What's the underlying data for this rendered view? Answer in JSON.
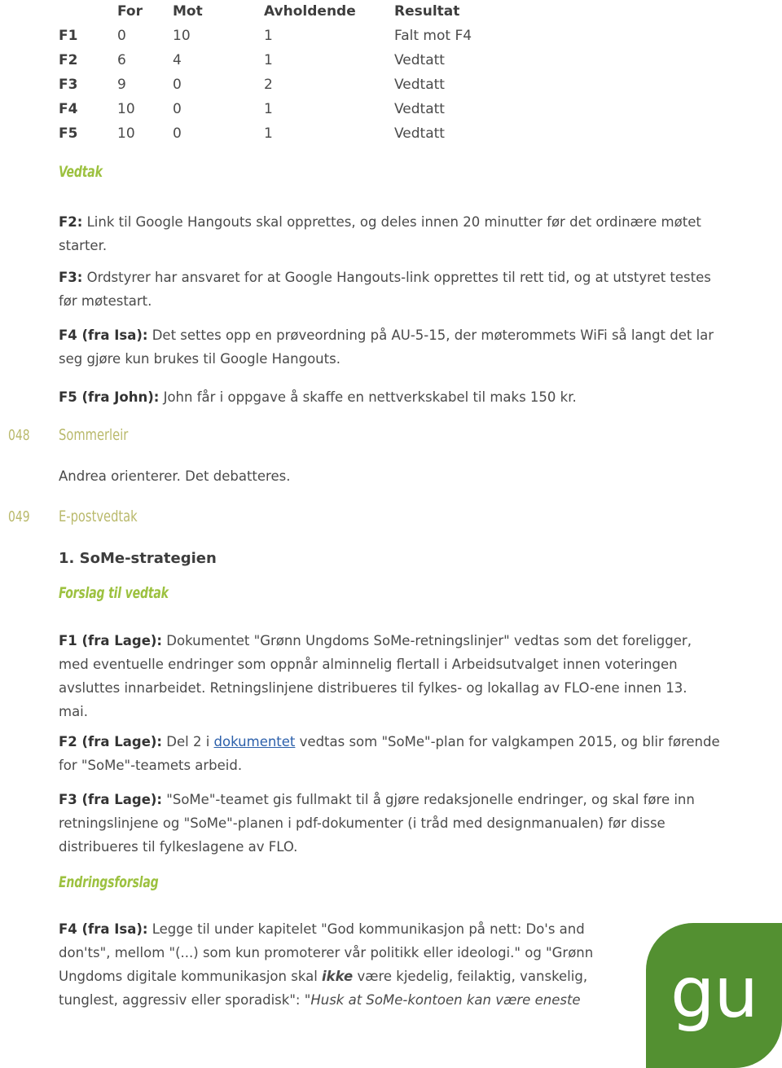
{
  "vote_table": {
    "headers": [
      "",
      "For",
      "Mot",
      "Avholdende",
      "Resultat"
    ],
    "rows": [
      {
        "label": "F1",
        "for": "0",
        "mot": "10",
        "avholdende": "1",
        "resultat": "Falt mot F4"
      },
      {
        "label": "F2",
        "for": "6",
        "mot": "4",
        "avholdende": "1",
        "resultat": "Vedtatt"
      },
      {
        "label": "F3",
        "for": "9",
        "mot": "0",
        "avholdende": "2",
        "resultat": "Vedtatt"
      },
      {
        "label": "F4",
        "for": "10",
        "mot": "0",
        "avholdende": "1",
        "resultat": "Vedtatt"
      },
      {
        "label": "F5",
        "for": "10",
        "mot": "0",
        "avholdende": "1",
        "resultat": "Vedtatt"
      }
    ]
  },
  "vedtak": {
    "heading": "Vedtak",
    "items": [
      {
        "label": "F2:",
        "text": " Link til Google Hangouts skal opprettes, og deles innen 20 minutter før det ordinære møtet starter."
      },
      {
        "label": "F3:",
        "text": " Ordstyrer har ansvaret for at Google Hangouts-link opprettes til rett tid, og at utstyret testes før møtestart."
      },
      {
        "label": "F4 (fra Isa):",
        "text": " Det settes opp en prøveordning på AU-5-15, der møterommets WiFi så langt det lar seg gjøre kun brukes til Google Hangouts."
      },
      {
        "label": "F5 (fra John):",
        "text": " John får i oppgave å skaffe en nettverkskabel til maks 150 kr."
      }
    ]
  },
  "agenda": [
    {
      "number": "048",
      "title": "Sommerleir"
    },
    {
      "number": "049",
      "title": "E-postvedtak"
    }
  ],
  "sommerleir": {
    "body": "Andrea orienterer. Det debatteres."
  },
  "epostvedtak": {
    "item_heading": "1. SoMe-strategien",
    "forslag_heading": "Forslag til vedtak",
    "f1": {
      "label": "F1 (fra Lage):",
      "text": " Dokumentet \"Grønn Ungdoms SoMe-retningslinjer\" vedtas som det foreligger, med eventuelle endringer som oppnår alminnelig flertall i Arbeidsutvalget innen voteringen avsluttes innarbeidet. Retningslinjene distribueres til fylkes- og lokallag av FLO-ene innen 13. mai."
    },
    "f2": {
      "label": "F2 (fra Lage):",
      "text_before": " Del 2 i ",
      "link": "dokumentet",
      "text_after": " vedtas som \"SoMe\"-plan for valgkampen 2015, og blir førende for \"SoMe\"-teamets arbeid."
    },
    "f3": {
      "label": "F3 (fra Lage):",
      "text": " \"SoMe\"-teamet gis fullmakt til å gjøre redaksjonelle endringer, og skal føre inn retningslinjene og \"SoMe\"-planen i pdf-dokumenter (i tråd med designmanualen) før disse distribueres til fylkeslagene av FLO."
    },
    "endringsforslag_heading": "Endringsforslag",
    "f4": {
      "label": "F4 (fra Isa):",
      "text_1": " Legge til under kapitelet \"God kommunikasjon på nett: Do's and don'ts\", mellom \"(...) som kun promoterer vår politikk eller ideologi.\" og \"Grønn Ungdoms digitale kommunikasjon skal ",
      "emphasis": "ikke",
      "text_2": " være kjedelig, feilaktig, vanskelig, tunglest, aggressiv eller sporadisk\": \"",
      "italic_quote": "Husk at SoMe-kontoen kan være eneste"
    }
  },
  "logo": {
    "text": "gu",
    "color": "#539031"
  },
  "colors": {
    "green_heading": "#9cc13f",
    "olive_agenda": "#b9b96b",
    "link_blue": "#2b5faa",
    "body_text": "#4a4a4a"
  }
}
